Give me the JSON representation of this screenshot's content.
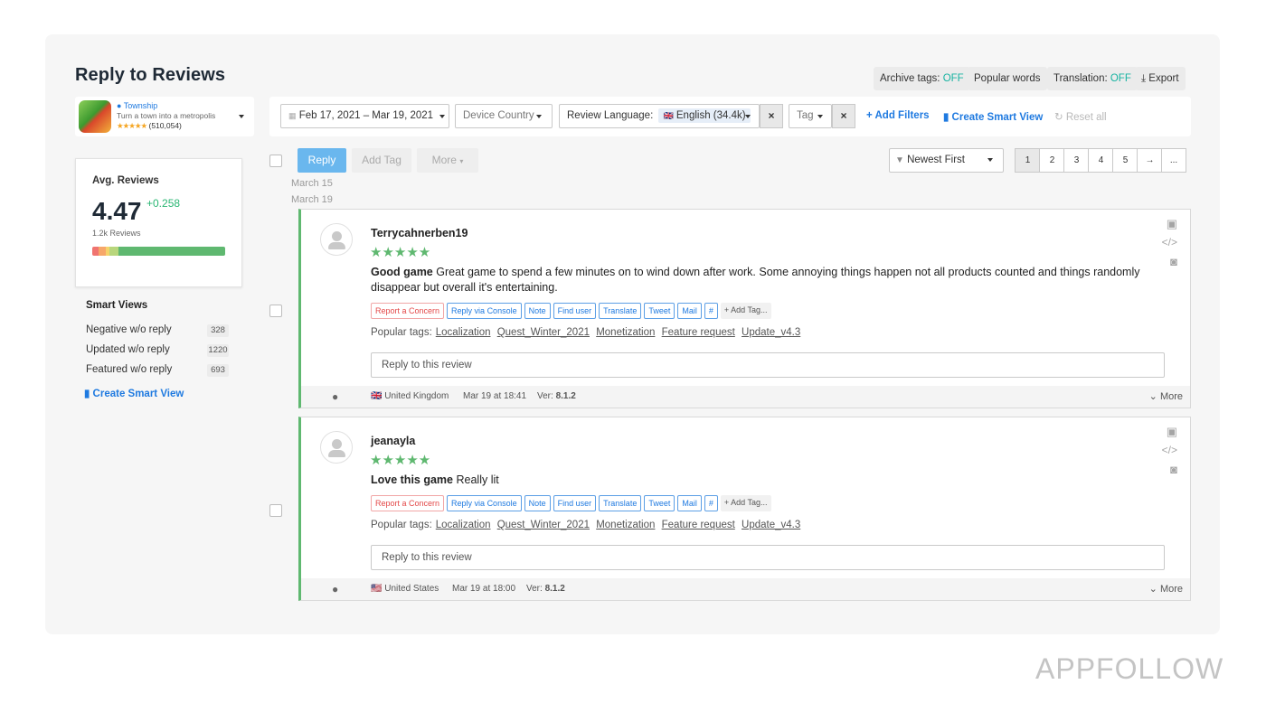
{
  "page": {
    "title": "Reply to Reviews"
  },
  "top_buttons": {
    "archive_tags": {
      "label": "Archive tags:",
      "state": "OFF"
    },
    "popular_words": "Popular words",
    "translation": {
      "label": "Translation:",
      "state": "OFF"
    },
    "export": "Export"
  },
  "app": {
    "name": "Township",
    "description": "Turn a town into a metropolis",
    "rating_count": "(510,054)",
    "stars": "★★★★★"
  },
  "filters": {
    "date_range": "Feb 17, 2021 – Mar 19, 2021",
    "device_country": "Device Country",
    "review_language_label": "Review Language:",
    "review_language_value": "English (34.4k)",
    "tag": "Tag",
    "clear": "×",
    "add_filters": "Add Filters",
    "create_smart_view": "Create Smart View",
    "reset_all": "Reset all"
  },
  "avg_reviews": {
    "title": "Avg. Reviews",
    "value": "4.47",
    "delta": "+0.258",
    "count": "1.2k Reviews",
    "bar_colors": [
      "#f07470",
      "#f7a76a",
      "#f5d36b",
      "#b8d67c",
      "#5fb870"
    ],
    "bar_shares": [
      0.05,
      0.05,
      0.03,
      0.07,
      0.8
    ]
  },
  "smart_views": {
    "title": "Smart Views",
    "items": [
      {
        "label": "Negative w/o reply",
        "count": "328"
      },
      {
        "label": "Updated w/o reply",
        "count": "1220"
      },
      {
        "label": "Featured w/o reply",
        "count": "693"
      }
    ],
    "create": "Create Smart View"
  },
  "toolbar": {
    "reply": "Reply",
    "add_tag": "Add Tag",
    "more": "More",
    "sort": "Newest First"
  },
  "pagination": [
    "1",
    "2",
    "3",
    "4",
    "5",
    "→",
    "..."
  ],
  "dates": [
    "March 15",
    "March 19"
  ],
  "action_labels": {
    "report": "Report a Concern",
    "console": "Reply via Console",
    "note": "Note",
    "find_user": "Find user",
    "translate": "Translate",
    "tweet": "Tweet",
    "mail": "Mail",
    "hash": "#",
    "add_tag": "Add Tag..."
  },
  "popular_tags_label": "Popular tags:",
  "popular_tags": [
    "Localization",
    "Quest_Winter_2021",
    "Monetization",
    "Feature request",
    "Update_v4.3"
  ],
  "reply_placeholder": "Reply to this review",
  "more_label": "More",
  "reviews": [
    {
      "author": "Terrycahnerben19",
      "stars": "★★★★★",
      "title": "Good game",
      "body": "Great game to spend a few minutes on to wind down after work. Some annoying things happen not all products counted and things randomly disappear but overall it's entertaining.",
      "flag": "🇬🇧",
      "country": "United Kingdom",
      "date": "Mar 19 at 18:41",
      "ver_label": "Ver:",
      "version": "8.1.2"
    },
    {
      "author": "jeanayla",
      "stars": "★★★★★",
      "title": "Love this game",
      "body": "Really lit",
      "flag": "🇺🇸",
      "country": "United States",
      "date": "Mar 19 at 18:00",
      "ver_label": "Ver:",
      "version": "8.1.2"
    }
  ],
  "watermark": "APPFOLLOW",
  "colors": {
    "accent": "#1f7ae0",
    "teal": "#16b3a1",
    "green": "#5fb870",
    "reply_btn": "#6ab7ee"
  }
}
